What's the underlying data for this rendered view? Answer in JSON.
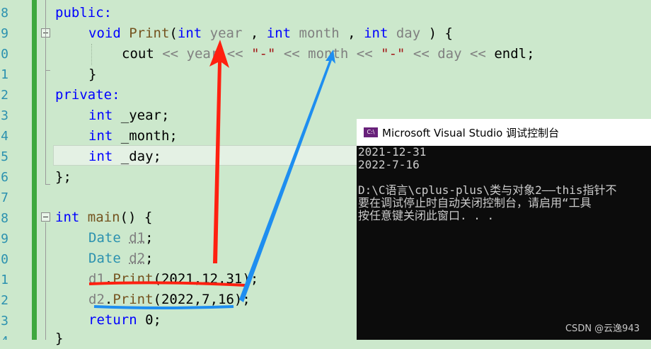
{
  "editor": {
    "line_numbers": [
      "8",
      "9",
      "0",
      "1",
      "2",
      "3",
      "4",
      "5",
      "6",
      "7",
      "8",
      "9",
      "0",
      "1",
      "2",
      "3",
      "4"
    ],
    "code": {
      "l_public": "public:",
      "l_print_void": "void",
      "l_print_name": "Print",
      "l_print_open": "(",
      "l_int": "int",
      "l_year": "year",
      "l_month": "month",
      "l_day": "day",
      "l_comma": " , ",
      "l_close_brace_open": " ) {",
      "l_cout": "cout",
      "l_shift": " << ",
      "l_dash": "\"-\"",
      "l_endl": "endl;",
      "l_close": "}",
      "l_private": "private:",
      "l_f_year": "_year;",
      "l_f_month": "_month;",
      "l_f_day": "_day;",
      "l_class_end": "};",
      "l_main_int": "int",
      "l_main": "main",
      "l_main_rest": "() {",
      "l_date": "Date",
      "l_d1": "d1",
      "l_d2": "d2",
      "l_semi": ";",
      "l_d1_call": "d1.Print(2021,12,31);",
      "l_d1_obj": "d1",
      "l_dot": ".",
      "l_print": "Print",
      "l_args1": "(2021,12,31)",
      "l_d2_obj": "d2",
      "l_args2": "(2022,7,16)",
      "l_return": "return",
      "l_zero": " 0;"
    }
  },
  "console": {
    "title": "Microsoft Visual Studio 调试控制台",
    "icon_text": "C:\\",
    "lines": [
      "2021-12-31",
      "2022-7-16",
      "",
      "D:\\C语言\\cplus-plus\\类与对象2——this指针不",
      "要在调试停止时自动关闭控制台，请启用“工具",
      "按任意键关闭此窗口. . ."
    ]
  },
  "watermark": "CSDN @云逸943",
  "colors": {
    "editor_bg": "#cce8cc",
    "keyword": "#0000ff",
    "type_name": "#2b91af",
    "function": "#74531f",
    "parameter": "#808080",
    "string": "#a31515",
    "arrow_red": "#ff2010",
    "arrow_blue": "#1e8ef0",
    "console_bg": "#0c0c0c"
  }
}
